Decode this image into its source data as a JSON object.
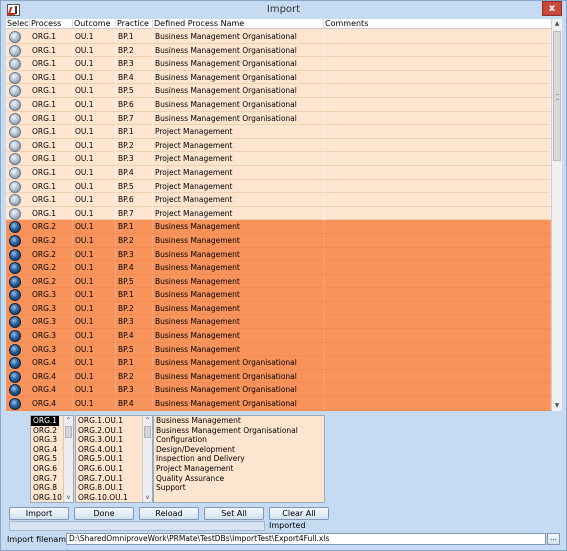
{
  "window": {
    "title": "Import",
    "close_glyph": "x"
  },
  "columns": [
    "Select",
    "Process",
    "Outcome",
    "Practice",
    "Defined Process Name",
    "Comments"
  ],
  "rows": [
    {
      "selected": false,
      "process": "ORG.1",
      "outcome": "OU.1",
      "practice": "BP.1",
      "name": "Business Management Organisational",
      "comment": ""
    },
    {
      "selected": false,
      "process": "ORG.1",
      "outcome": "OU.1",
      "practice": "BP.2",
      "name": "Business Management Organisational",
      "comment": ""
    },
    {
      "selected": false,
      "process": "ORG.1",
      "outcome": "OU.1",
      "practice": "BP.3",
      "name": "Business Management Organisational",
      "comment": ""
    },
    {
      "selected": false,
      "process": "ORG.1",
      "outcome": "OU.1",
      "practice": "BP.4",
      "name": "Business Management Organisational",
      "comment": ""
    },
    {
      "selected": false,
      "process": "ORG.1",
      "outcome": "OU.1",
      "practice": "BP.5",
      "name": "Business Management Organisational",
      "comment": ""
    },
    {
      "selected": false,
      "process": "ORG.1",
      "outcome": "OU.1",
      "practice": "BP.6",
      "name": "Business Management Organisational",
      "comment": ""
    },
    {
      "selected": false,
      "process": "ORG.1",
      "outcome": "OU.1",
      "practice": "BP.7",
      "name": "Business Management Organisational",
      "comment": ""
    },
    {
      "selected": false,
      "process": "ORG.1",
      "outcome": "OU.1",
      "practice": "BP.1",
      "name": "Project Management",
      "comment": ""
    },
    {
      "selected": false,
      "process": "ORG.1",
      "outcome": "OU.1",
      "practice": "BP.2",
      "name": "Project Management",
      "comment": ""
    },
    {
      "selected": false,
      "process": "ORG.1",
      "outcome": "OU.1",
      "practice": "BP.3",
      "name": "Project Management",
      "comment": ""
    },
    {
      "selected": false,
      "process": "ORG.1",
      "outcome": "OU.1",
      "practice": "BP.4",
      "name": "Project Management",
      "comment": ""
    },
    {
      "selected": false,
      "process": "ORG.1",
      "outcome": "OU.1",
      "practice": "BP.5",
      "name": "Project Management",
      "comment": ""
    },
    {
      "selected": false,
      "process": "ORG.1",
      "outcome": "OU.1",
      "practice": "BP.6",
      "name": "Project Management",
      "comment": ""
    },
    {
      "selected": false,
      "process": "ORG.1",
      "outcome": "OU.1",
      "practice": "BP.7",
      "name": "Project Management",
      "comment": ""
    },
    {
      "selected": true,
      "process": "ORG.2",
      "outcome": "OU.1",
      "practice": "BP.1",
      "name": "Business Management",
      "comment": ""
    },
    {
      "selected": true,
      "process": "ORG.2",
      "outcome": "OU.1",
      "practice": "BP.2",
      "name": "Business Management",
      "comment": ""
    },
    {
      "selected": true,
      "process": "ORG.2",
      "outcome": "OU.1",
      "practice": "BP.3",
      "name": "Business Management",
      "comment": ""
    },
    {
      "selected": true,
      "process": "ORG.2",
      "outcome": "OU.1",
      "practice": "BP.4",
      "name": "Business Management",
      "comment": ""
    },
    {
      "selected": true,
      "process": "ORG.2",
      "outcome": "OU.1",
      "practice": "BP.5",
      "name": "Business Management",
      "comment": ""
    },
    {
      "selected": true,
      "process": "ORG.3",
      "outcome": "OU.1",
      "practice": "BP.1",
      "name": "Business Management",
      "comment": ""
    },
    {
      "selected": true,
      "process": "ORG.3",
      "outcome": "OU.1",
      "practice": "BP.2",
      "name": "Business Management",
      "comment": ""
    },
    {
      "selected": true,
      "process": "ORG.3",
      "outcome": "OU.1",
      "practice": "BP.3",
      "name": "Business Management",
      "comment": ""
    },
    {
      "selected": true,
      "process": "ORG.3",
      "outcome": "OU.1",
      "practice": "BP.4",
      "name": "Business Management",
      "comment": ""
    },
    {
      "selected": true,
      "process": "ORG.3",
      "outcome": "OU.1",
      "practice": "BP.5",
      "name": "Business Management",
      "comment": ""
    },
    {
      "selected": true,
      "process": "ORG.4",
      "outcome": "OU.1",
      "practice": "BP.1",
      "name": "Business Management Organisational",
      "comment": ""
    },
    {
      "selected": true,
      "process": "ORG.4",
      "outcome": "OU.1",
      "practice": "BP.2",
      "name": "Business Management Organisational",
      "comment": ""
    },
    {
      "selected": true,
      "process": "ORG.4",
      "outcome": "OU.1",
      "practice": "BP.3",
      "name": "Business Management Organisational",
      "comment": ""
    },
    {
      "selected": true,
      "process": "ORG.4",
      "outcome": "OU.1",
      "practice": "BP.4",
      "name": "Business Management Organisational",
      "comment": ""
    }
  ],
  "process_list": [
    "ORG.1",
    "ORG.2",
    "ORG.3",
    "ORG.4",
    "ORG.5",
    "ORG.6",
    "ORG.7",
    "ORG.8",
    "ORG.10"
  ],
  "outcome_list": [
    "ORG.1.OU.1",
    "ORG.2.OU.1",
    "ORG.3.OU.1",
    "ORG.4.OU.1",
    "ORG.5.OU.1",
    "ORG.6.OU.1",
    "ORG.7.OU.1",
    "ORG.8.OU.1",
    "ORG.10.OU.1"
  ],
  "name_list": [
    "Business Management",
    "Business Management Organisational",
    "Configuration",
    "Design/Development",
    "Inspection and Delivery",
    "Project Management",
    "Quality Assurance",
    "Support"
  ],
  "buttons": {
    "import": "Import",
    "done": "Done",
    "reload": "Reload",
    "set_all": "Set All",
    "clear_all": "Clear All"
  },
  "status": "Imported",
  "filename": {
    "label": "Import filename",
    "value": "D:\\SharedOmniproveWork\\PRMate\\TestDBs\\ImportTest\\Export4Full.xls",
    "browse": "..."
  },
  "colors": {
    "selected_row": "#f8935b",
    "unselected_row": "#fde5cf",
    "background": "#c6dbf1"
  }
}
